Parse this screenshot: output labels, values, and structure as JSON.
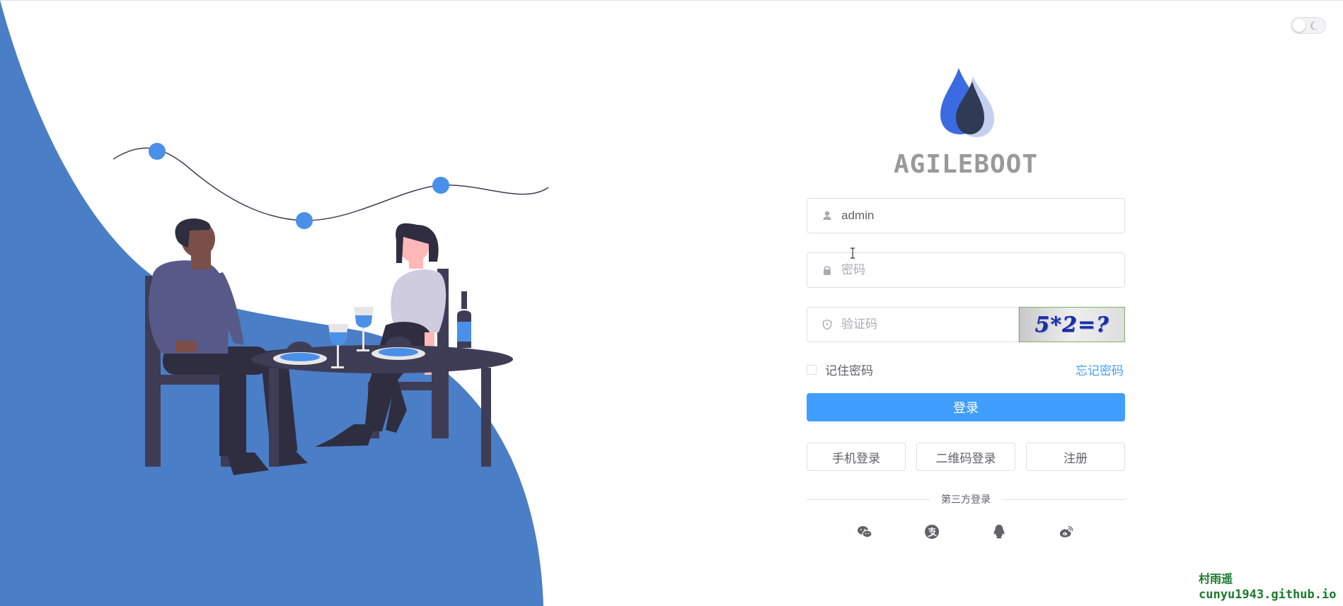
{
  "app": {
    "brand": "AGILEBOOT"
  },
  "login_form": {
    "username": {
      "value": "admin",
      "placeholder": ""
    },
    "password": {
      "value": "",
      "placeholder": "密码"
    },
    "captcha": {
      "value": "",
      "placeholder": "验证码",
      "image_text": "5*2=?"
    },
    "remember_label": "记住密码",
    "remember_checked": false,
    "forgot_label": "忘记密码",
    "login_label": "登录"
  },
  "alt_login": {
    "phone_label": "手机登录",
    "qrcode_label": "二维码登录",
    "register_label": "注册"
  },
  "third_party": {
    "label": "第三方登录",
    "providers": [
      "wechat-icon",
      "alipay-icon",
      "qq-icon",
      "weibo-icon"
    ]
  },
  "theme_toggle": {
    "mode": "light"
  },
  "watermark": {
    "line1": "村雨遥",
    "line2": "cunyu1943.github.io"
  },
  "colors": {
    "primary": "#409eff",
    "illustration_blue": "#4a7ec7",
    "brand_text": "#999999"
  }
}
